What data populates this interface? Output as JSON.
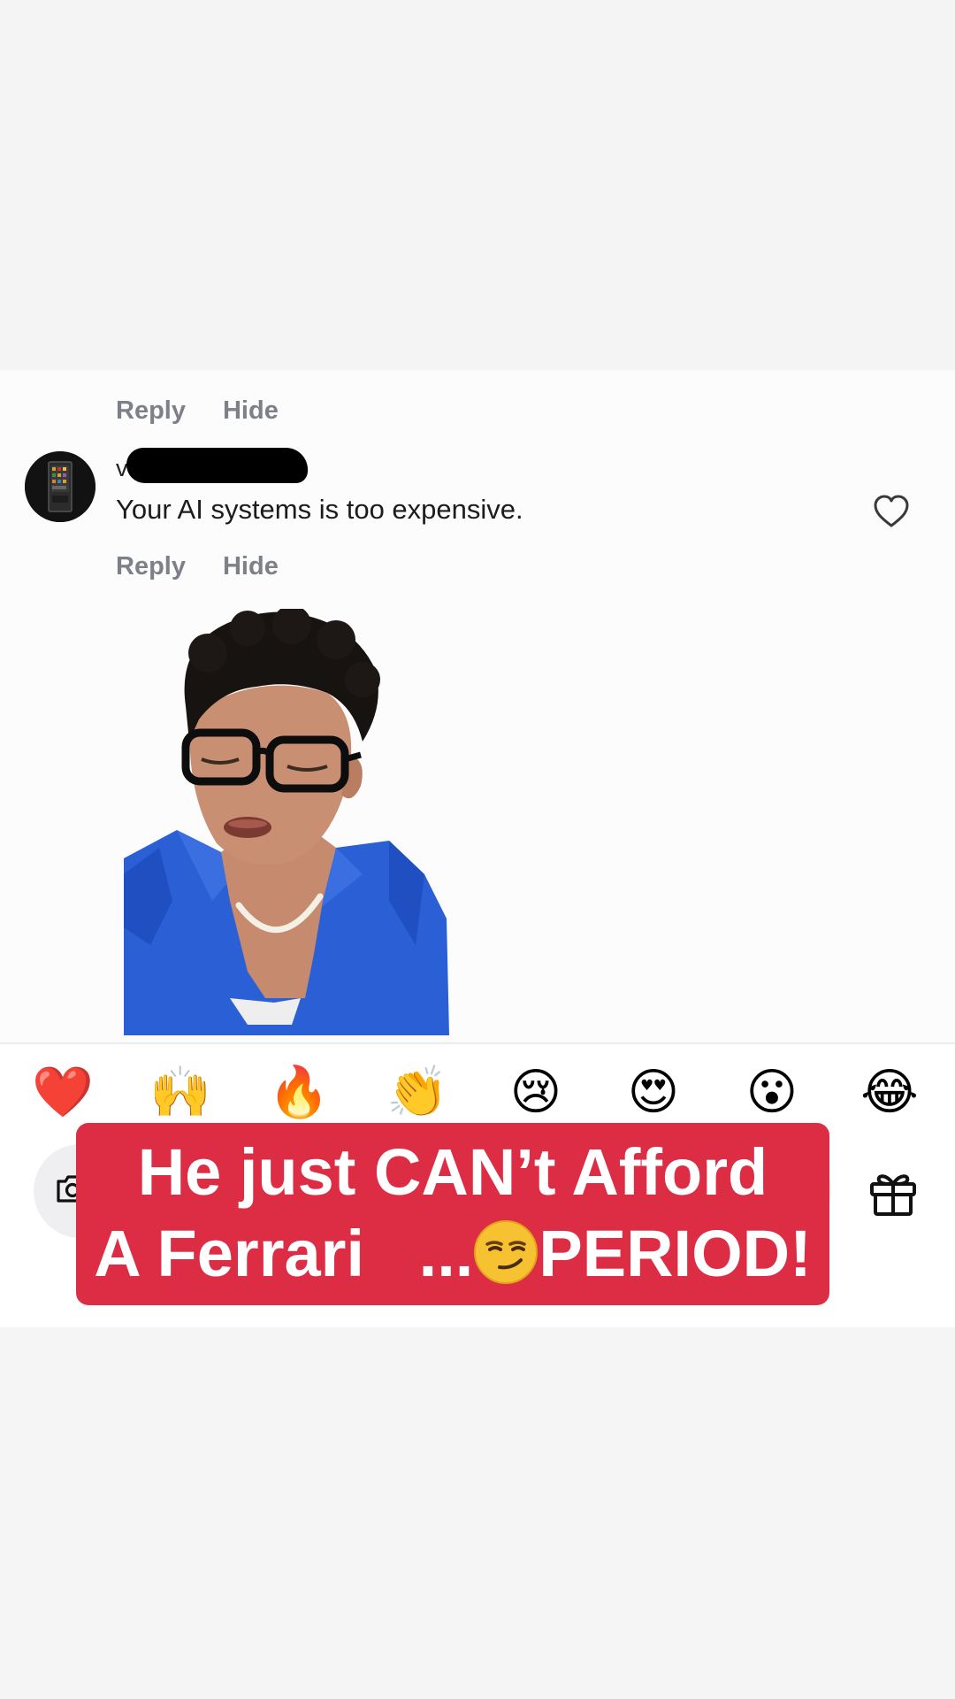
{
  "first_comment": {
    "actions": {
      "reply_label": "Reply",
      "hide_label": "Hide"
    }
  },
  "second_comment": {
    "username_visible": "v",
    "text": "Your AI systems is too expensive.",
    "actions": {
      "reply_label": "Reply",
      "hide_label": "Hide"
    }
  },
  "emoji_bar": [
    "❤️",
    "🙌",
    "🔥",
    "👏",
    "😢",
    "😍",
    "😮",
    "😂"
  ],
  "caption": {
    "line1": "He just CAN’t Afford",
    "line2_before": "A Ferrari   ...",
    "line2_after": "PERIOD!",
    "background_color": "#dc2d45"
  },
  "icons": [
    "camera-icon",
    "heart-outline-icon",
    "gift-icon",
    "smirk-emoji-icon"
  ]
}
